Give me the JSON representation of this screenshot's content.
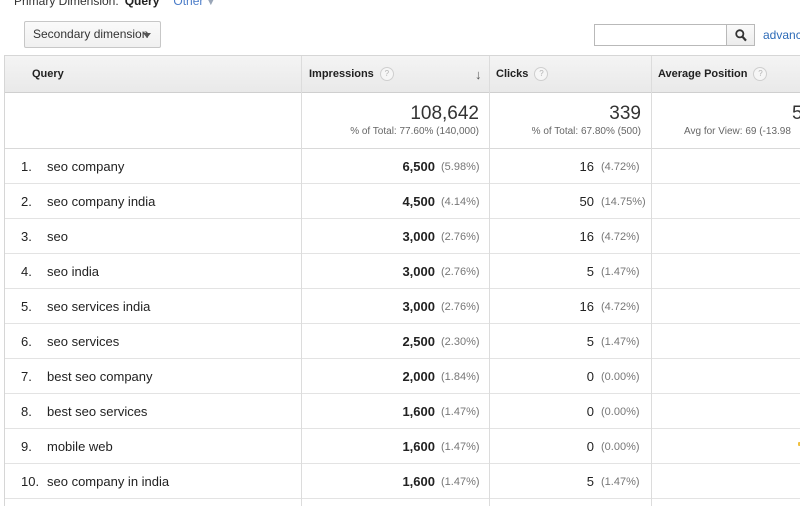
{
  "top": {
    "primary_label": "Primary Dimension:",
    "primary_value": "Query",
    "other_label": "Other"
  },
  "toolbar": {
    "secondary_dimension_label": "Secondary dimension",
    "search_placeholder": "",
    "advanced_label": "advanc"
  },
  "table": {
    "headers": {
      "query": "Query",
      "impressions": "Impressions",
      "clicks": "Clicks",
      "avg_position": "Average Position"
    },
    "help_glyph": "?",
    "sort_glyph": "↓",
    "totals": {
      "impressions": "108,642",
      "impressions_sub": "% of Total: 77.60% (140,000)",
      "clicks": "339",
      "clicks_sub": "% of Total: 67.80% (500)",
      "avg_position": "5",
      "avg_position_sub": "Avg for View: 69 (-13.98"
    },
    "rows": [
      {
        "idx": "1.",
        "query": "seo company",
        "impressions": "6,500",
        "impressions_pct": "(5.98%)",
        "clicks": "16",
        "clicks_pct": "(4.72%)"
      },
      {
        "idx": "2.",
        "query": "seo company india",
        "impressions": "4,500",
        "impressions_pct": "(4.14%)",
        "clicks": "50",
        "clicks_pct": "(14.75%)"
      },
      {
        "idx": "3.",
        "query": "seo",
        "impressions": "3,000",
        "impressions_pct": "(2.76%)",
        "clicks": "16",
        "clicks_pct": "(4.72%)"
      },
      {
        "idx": "4.",
        "query": "seo india",
        "impressions": "3,000",
        "impressions_pct": "(2.76%)",
        "clicks": "5",
        "clicks_pct": "(1.47%)"
      },
      {
        "idx": "5.",
        "query": "seo services india",
        "impressions": "3,000",
        "impressions_pct": "(2.76%)",
        "clicks": "16",
        "clicks_pct": "(4.72%)"
      },
      {
        "idx": "6.",
        "query": "seo services",
        "impressions": "2,500",
        "impressions_pct": "(2.30%)",
        "clicks": "5",
        "clicks_pct": "(1.47%)"
      },
      {
        "idx": "7.",
        "query": "best seo company",
        "impressions": "2,000",
        "impressions_pct": "(1.84%)",
        "clicks": "0",
        "clicks_pct": "(0.00%)"
      },
      {
        "idx": "8.",
        "query": "best seo services",
        "impressions": "1,600",
        "impressions_pct": "(1.47%)",
        "clicks": "0",
        "clicks_pct": "(0.00%)"
      },
      {
        "idx": "9.",
        "query": "mobile web",
        "impressions": "1,600",
        "impressions_pct": "(1.47%)",
        "clicks": "0",
        "clicks_pct": "(0.00%)"
      },
      {
        "idx": "10.",
        "query": "seo company in india",
        "impressions": "1,600",
        "impressions_pct": "(1.47%)",
        "clicks": "5",
        "clicks_pct": "(1.47%)"
      }
    ]
  }
}
